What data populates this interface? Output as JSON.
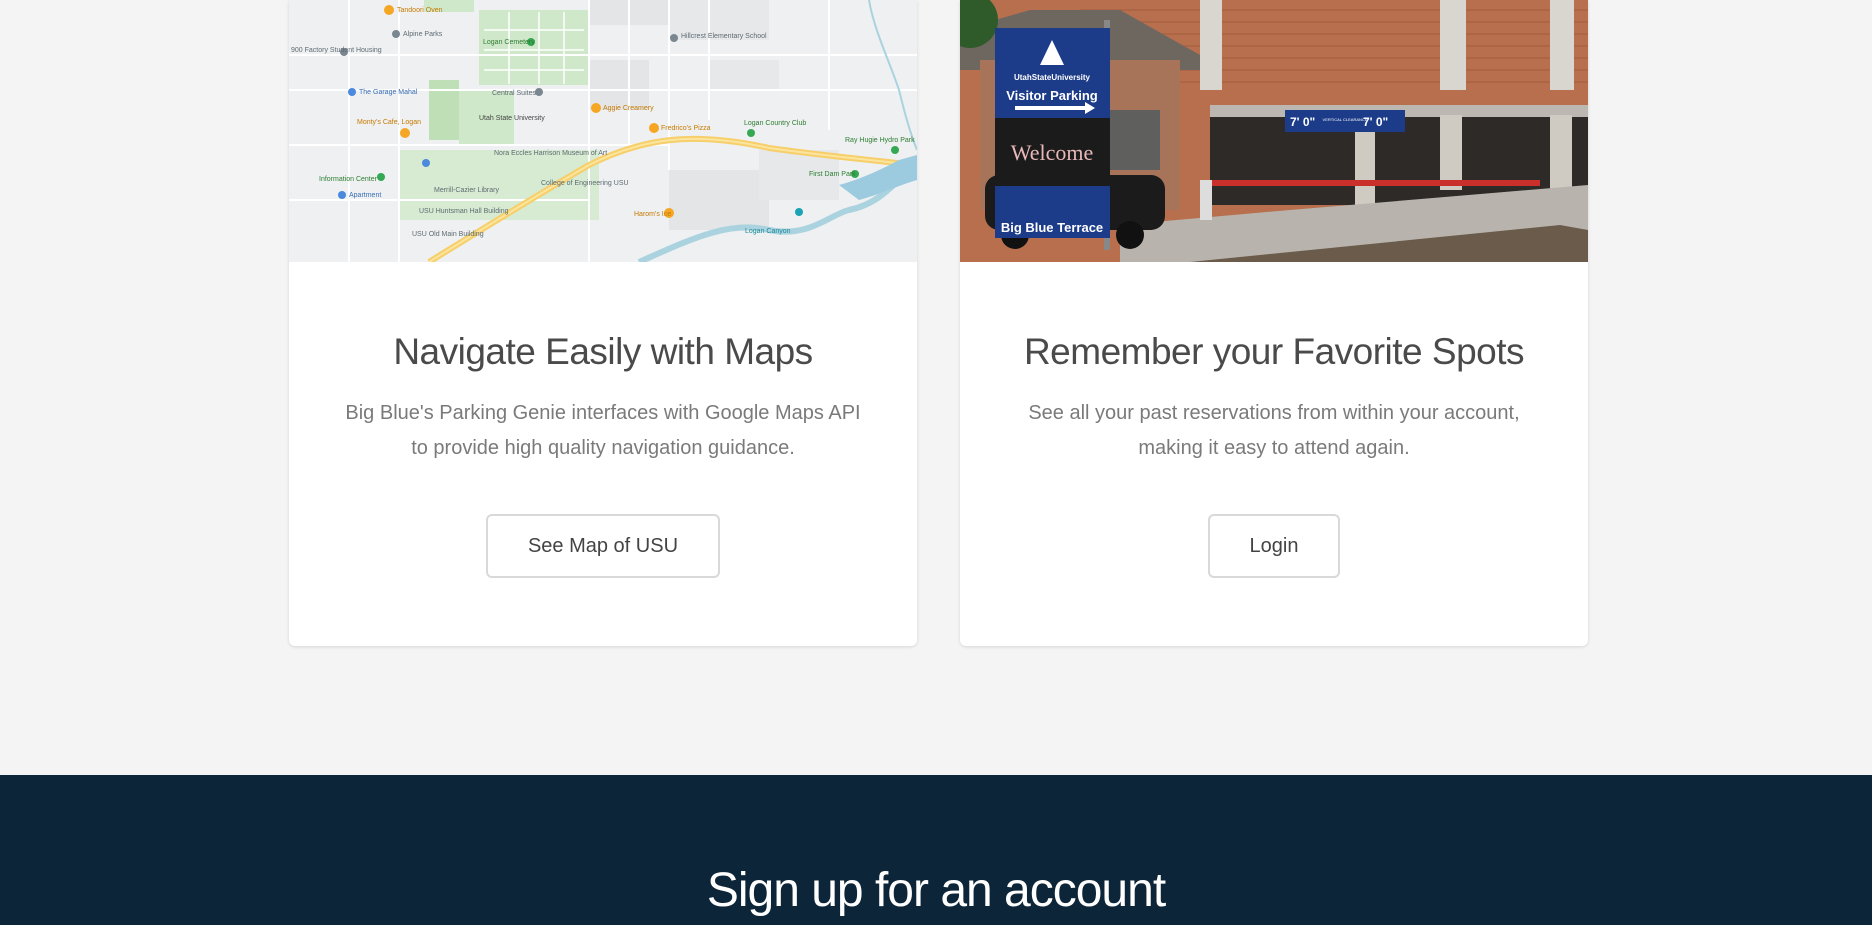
{
  "cards": [
    {
      "title": "Navigate Easily with Maps",
      "text": "Big Blue's Parking Genie interfaces with Google Maps API to provide high quality navigation guidance.",
      "button_label": "See Map of USU",
      "image": "map-image",
      "map_labels": {
        "tandoori": "Tandoori Oven",
        "alpine": "Alpine Parks",
        "factory": "900 Factory Student Housing",
        "logan_cemetery": "Logan Cemetery",
        "hillcrest": "Hillcrest Elementary School",
        "garage": "The Garage Mahal",
        "suites": "Central Suites",
        "usu": "Utah State University",
        "aggie": "Aggie Creamery",
        "fredricos": "Fredrico's Pizza",
        "country_club": "Logan Country Club",
        "monty": "Monty's Cafe, Logan",
        "ray": "Ray Hugie Hydro Park",
        "nora": "Nora Eccles Harrison Museum of Art",
        "info": "Information Center",
        "library": "Merrill-Cazier Library",
        "college": "College of Engineering USU",
        "firstdam": "First Dam Park",
        "huntsman": "USU Huntsman Hall Building",
        "apartments": "Apartment",
        "haroons": "Harom's Ice",
        "canyon": "Logan Canyon",
        "oldmain": "USU Old Main Building"
      }
    },
    {
      "title": "Remember your Favorite Spots",
      "text": "See all your past reservations from within your account, making it easy to attend again.",
      "button_label": "Login",
      "image": "parking-garage-photo",
      "photo_labels": {
        "university": "UtahStateUniversity",
        "visitor": "Visitor Parking",
        "welcome": "Welcome",
        "terrace": "Big Blue Terrace",
        "clearance": "7' 0\"",
        "clearance_word": "VERTICAL CLEARANCE",
        "clearance2": "7' 0\""
      }
    }
  ],
  "signup": {
    "title": "Sign up for an account"
  },
  "colors": {
    "page_bg": "#f4f4f4",
    "card_bg": "#ffffff",
    "footer_bg": "#0d2538",
    "button_border": "#d9d9d9"
  }
}
